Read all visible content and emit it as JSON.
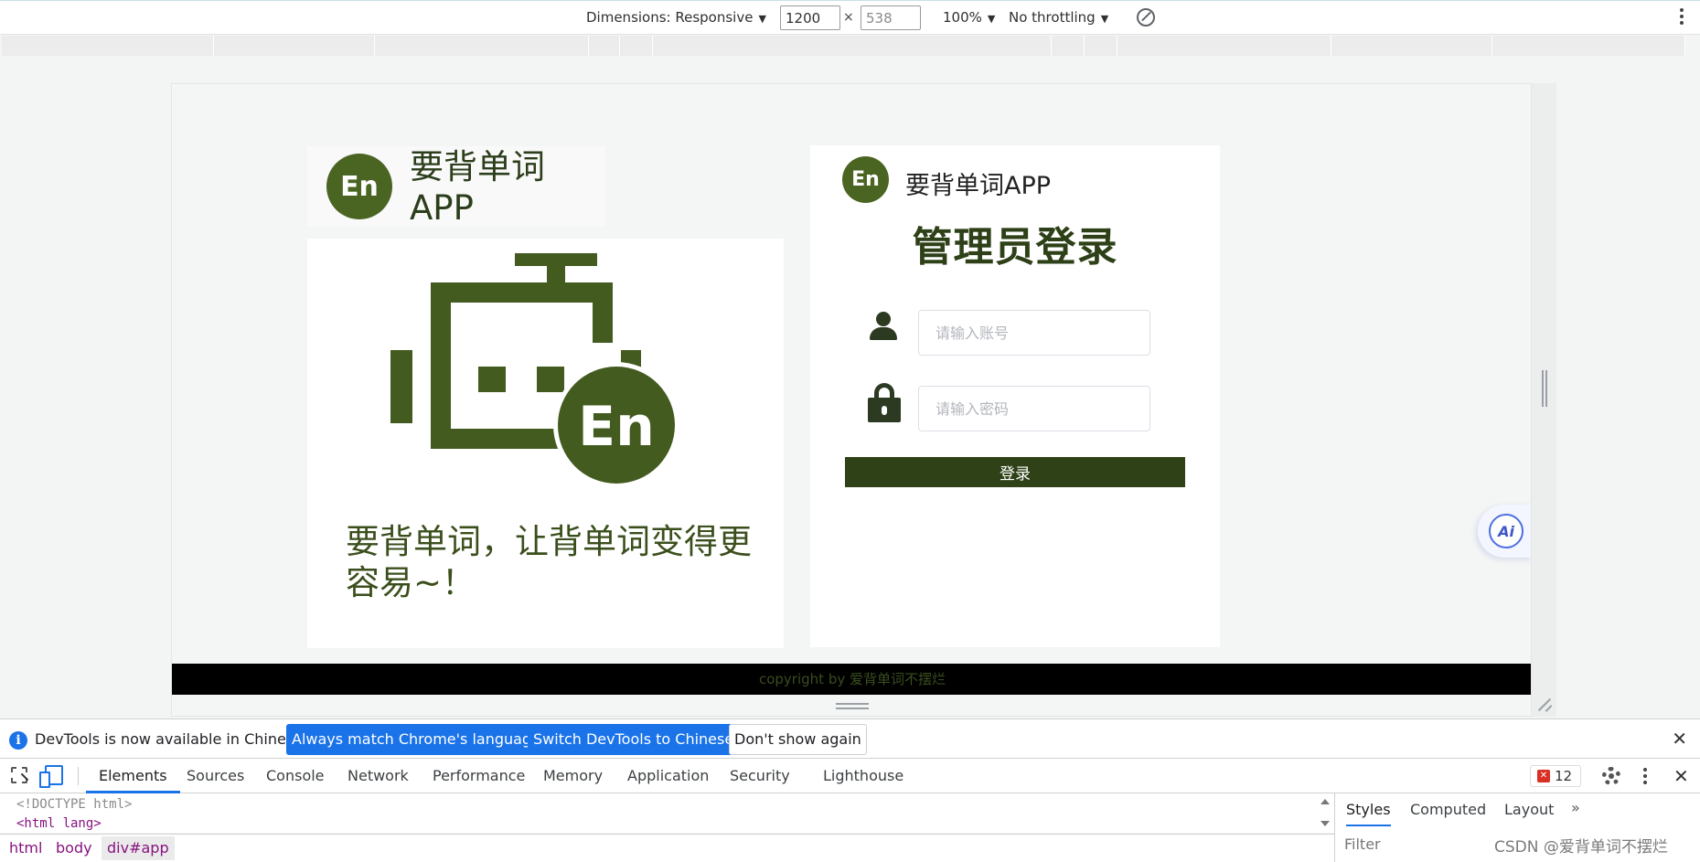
{
  "device_toolbar": {
    "dimensions_label": "Dimensions: Responsive",
    "width_value": "1200",
    "height_value": "538",
    "times": "×",
    "zoom": "100%",
    "throttling": "No throttling"
  },
  "page": {
    "brand_title": "要背单词APP",
    "logo_text": "En",
    "tagline": "要背单词，让背单词变得更容易~！",
    "login": {
      "brand": "要背单词APP",
      "heading": "管理员登录",
      "account_placeholder": "请输入账号",
      "password_placeholder": "请输入密码",
      "submit_label": "登录"
    },
    "ai_label": "Ai",
    "footer": "copyright by 爱背单词不摆烂"
  },
  "lang_bar": {
    "message": "DevTools is now available in Chinese!",
    "match_button": "Always match Chrome's language",
    "switch_button": "Switch DevTools to Chinese",
    "dismiss_button": "Don't show again",
    "info_icon": "i",
    "close": "✕"
  },
  "devtools": {
    "tabs": [
      "Elements",
      "Sources",
      "Console",
      "Network",
      "Performance",
      "Memory",
      "Application",
      "Security",
      "Lighthouse"
    ],
    "error_count": "12",
    "close": "✕",
    "code": {
      "doctype": "<!DOCTYPE html>",
      "html_open": "<html lang>"
    },
    "breadcrumb": [
      "html",
      "body",
      "div#app"
    ],
    "side_tabs": [
      "Styles",
      "Computed",
      "Layout"
    ],
    "side_more": "»",
    "filter_placeholder": "Filter",
    "watermark": "CSDN @爱背单词不摆烂"
  },
  "colors": {
    "brand_green": "#4a6422",
    "button_dark_green": "#2f4117",
    "devtools_blue": "#1a73e8"
  }
}
